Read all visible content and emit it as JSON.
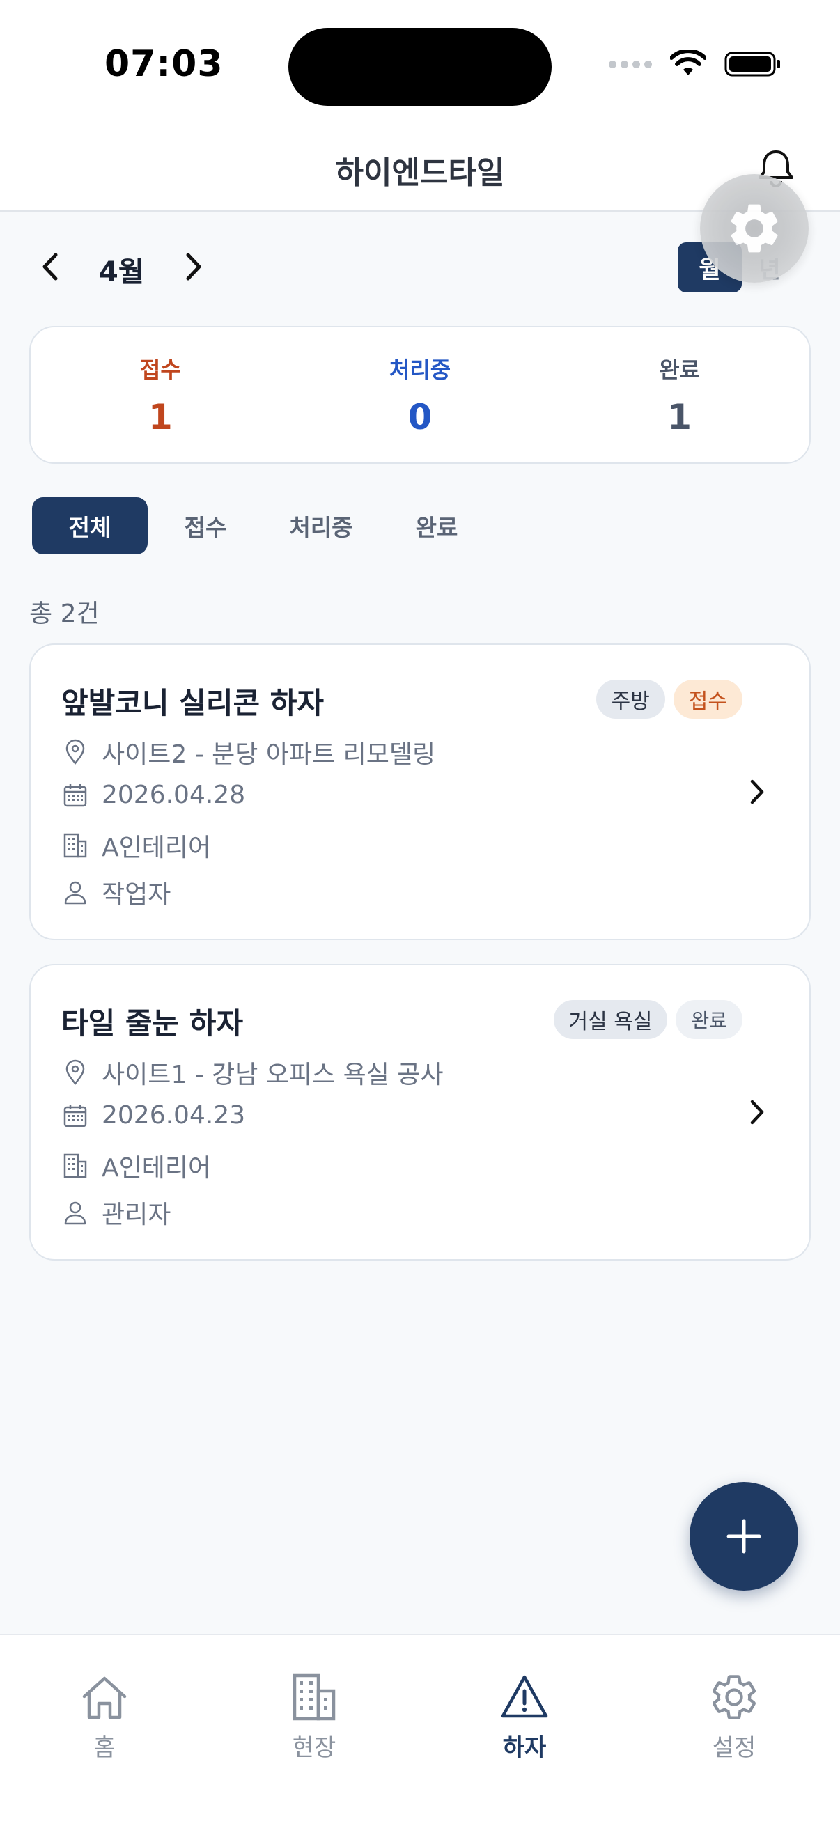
{
  "status_bar": {
    "time": "07:03"
  },
  "header": {
    "title": "하이엔드타일"
  },
  "period": {
    "month_label": "4월",
    "toggle": {
      "month": "월",
      "year": "년",
      "selected": "월"
    }
  },
  "summary": [
    {
      "label": "접수",
      "value": "1",
      "color": "#c0461e"
    },
    {
      "label": "처리중",
      "value": "0",
      "color": "#2457c5"
    },
    {
      "label": "완료",
      "value": "1",
      "color": "#4a5568"
    }
  ],
  "filter_tabs": [
    {
      "label": "전체",
      "active": true
    },
    {
      "label": "접수",
      "active": false
    },
    {
      "label": "처리중",
      "active": false
    },
    {
      "label": "완료",
      "active": false
    }
  ],
  "total_count": "총 2건",
  "defects": [
    {
      "title": "앞발코니 실리콘 하자",
      "location": "주방",
      "status": "접수",
      "site": "사이트2 - 분당 아파트 리모델링",
      "date": "2026.04.28",
      "company": "A인테리어",
      "person": "작업자"
    },
    {
      "title": "타일 줄눈 하자",
      "location": "거실 욕실",
      "status": "완료",
      "site": "사이트1 - 강남 오피스 욕실 공사",
      "date": "2026.04.23",
      "company": "A인테리어",
      "person": "관리자"
    }
  ],
  "bottom_nav": [
    {
      "label": "홈",
      "icon": "home-icon",
      "active": false
    },
    {
      "label": "현장",
      "icon": "building-icon",
      "active": false
    },
    {
      "label": "하자",
      "icon": "warning-icon",
      "active": true
    },
    {
      "label": "설정",
      "icon": "gear-icon",
      "active": false
    }
  ],
  "colors": {
    "primary": "#1f3a63",
    "received": "#c0461e",
    "processing": "#2457c5"
  }
}
